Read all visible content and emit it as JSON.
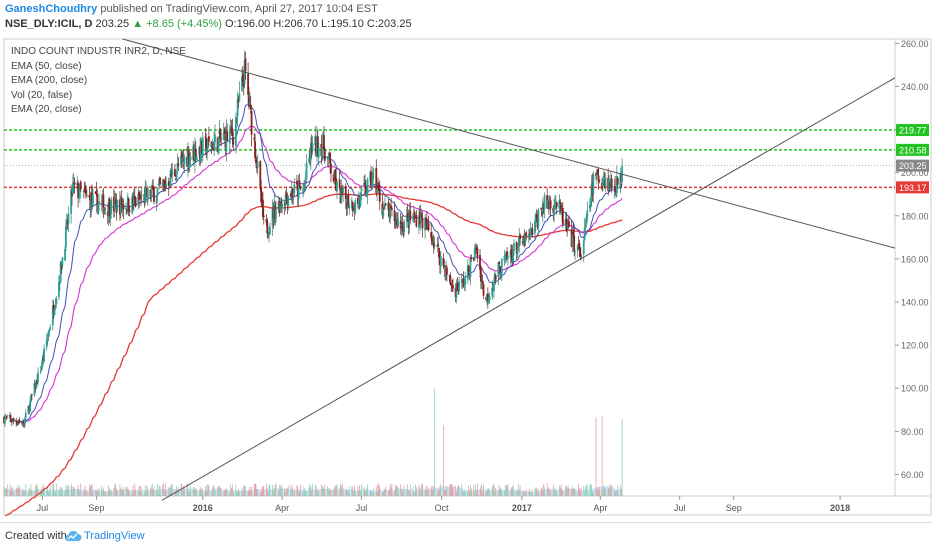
{
  "header": {
    "author": "GaneshChoudhry",
    "published_text": "published on TradingView.com, April 27, 2017 10:04 EST",
    "symbol": "NSE_DLY:ICIL, D",
    "price": "203.25",
    "change": "▲ +8.65 (+4.45%)",
    "ohlc": "O:196.00 H:206.70 L:195.10 C:203.25"
  },
  "legend": [
    "INDO COUNT INDUSTR INR2, D, NSE",
    "EMA (50, close)",
    "EMA (200, close)",
    "Vol (20, false)",
    "EMA (20, close)"
  ],
  "footer": {
    "created_with": "Created with",
    "brand": "TradingView"
  },
  "colors": {
    "up": "#26a69a",
    "down": "#c62828",
    "candle_body_down": "#8b1e1e",
    "ema20": "#3f51b5",
    "ema50": "#d633d6",
    "ema200": "#e53935",
    "trendline": "#555555",
    "green_level": "#22c322",
    "red_level": "#e53935",
    "volume": "#90caf9",
    "price_label": "#888888"
  },
  "chart_data": {
    "type": "candlestick",
    "ylim": [
      50,
      262
    ],
    "price_axis_ticks": [
      60,
      80,
      100,
      120,
      140,
      160,
      180,
      200,
      220,
      240,
      260
    ],
    "time_axis_ticks": [
      "Jul",
      "Sep",
      "2016",
      "Apr",
      "Jul",
      "Oct",
      "2017",
      "Apr",
      "Jul",
      "Sep",
      "2018"
    ],
    "time_axis_dates": [
      "2015-07-01",
      "2015-09-01",
      "2016-01-01",
      "2016-04-01",
      "2016-07-01",
      "2016-10-01",
      "2017-01-01",
      "2017-04-01",
      "2017-07-01",
      "2017-09-01",
      "2018-01-01"
    ],
    "time_range": [
      "2015-05-18",
      "2018-03-05"
    ],
    "price_anchors": [
      [
        "2015-05-18",
        86
      ],
      [
        "2015-06-10",
        84
      ],
      [
        "2015-07-01",
        112
      ],
      [
        "2015-07-20",
        150
      ],
      [
        "2015-08-05",
        193
      ],
      [
        "2015-08-25",
        187
      ],
      [
        "2015-09-15",
        184
      ],
      [
        "2015-10-15",
        186
      ],
      [
        "2015-11-15",
        193
      ],
      [
        "2015-12-15",
        208
      ],
      [
        "2016-01-05",
        212
      ],
      [
        "2016-01-20",
        215
      ],
      [
        "2016-02-05",
        218
      ],
      [
        "2016-02-18",
        247
      ],
      [
        "2016-03-02",
        208
      ],
      [
        "2016-03-12",
        172
      ],
      [
        "2016-03-25",
        184
      ],
      [
        "2016-04-10",
        191
      ],
      [
        "2016-04-25",
        192
      ],
      [
        "2016-05-05",
        212
      ],
      [
        "2016-05-18",
        213
      ],
      [
        "2016-06-05",
        190
      ],
      [
        "2016-06-25",
        185
      ],
      [
        "2016-07-15",
        198
      ],
      [
        "2016-07-25",
        184
      ],
      [
        "2016-08-15",
        176
      ],
      [
        "2016-09-05",
        180
      ],
      [
        "2016-09-20",
        170
      ],
      [
        "2016-10-15",
        145
      ],
      [
        "2016-10-28",
        150
      ],
      [
        "2016-11-10",
        165
      ],
      [
        "2016-11-20",
        140
      ],
      [
        "2016-12-05",
        155
      ],
      [
        "2016-12-25",
        165
      ],
      [
        "2017-01-10",
        170
      ],
      [
        "2017-01-25",
        185
      ],
      [
        "2017-02-10",
        186
      ],
      [
        "2017-02-25",
        170
      ],
      [
        "2017-03-10",
        162
      ],
      [
        "2017-03-25",
        198
      ],
      [
        "2017-04-05",
        197
      ],
      [
        "2017-04-15",
        194
      ],
      [
        "2017-04-24",
        196
      ],
      [
        "2017-04-26",
        203.25
      ]
    ],
    "series": [
      {
        "name": "EMA (20, close)"
      },
      {
        "name": "EMA (50, close)"
      },
      {
        "name": "EMA (200, close)"
      },
      {
        "name": "Vol (20, false)"
      }
    ],
    "horizontal_levels": [
      {
        "value": 219.77,
        "label": "219.77",
        "color": "green"
      },
      {
        "value": 210.58,
        "label": "210.58",
        "color": "green"
      },
      {
        "value": 203.25,
        "label": "203.25",
        "color": "gray"
      },
      {
        "value": 193.17,
        "label": "193.17",
        "color": "red"
      }
    ],
    "trendlines": [
      {
        "from": [
          "2015-10-01",
          262
        ],
        "to": [
          "2018-03-05",
          165
        ]
      },
      {
        "from": [
          "2015-11-15",
          48
        ],
        "to": [
          "2018-03-05",
          244
        ]
      }
    ],
    "volume_spikes": [
      {
        "date": "2016-09-24",
        "value": 108
      },
      {
        "date": "2016-10-02",
        "value": 71
      },
      {
        "date": "2017-03-26",
        "value": 79
      },
      {
        "date": "2017-04-02",
        "value": 80
      },
      {
        "date": "2017-04-26",
        "value": 77
      }
    ]
  }
}
